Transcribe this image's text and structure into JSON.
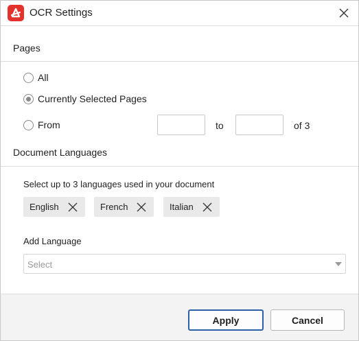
{
  "dialog": {
    "title": "OCR Settings",
    "icon": "app-logo-icon",
    "close_icon": "close-icon"
  },
  "pages": {
    "heading": "Pages",
    "options": [
      {
        "label": "All",
        "selected": false
      },
      {
        "label": "Currently Selected Pages",
        "selected": true
      },
      {
        "label": "From",
        "selected": false
      }
    ],
    "from_value": "",
    "to_value": "",
    "to_label": "to",
    "of_label": "of 3"
  },
  "languages": {
    "heading": "Document Languages",
    "helper": "Select up to 3 languages used in your document",
    "chips": [
      "English",
      "French",
      "Italian"
    ],
    "add_label": "Add Language",
    "select_placeholder": "Select"
  },
  "footer": {
    "apply_label": "Apply",
    "cancel_label": "Cancel"
  },
  "colors": {
    "brand": "#e2322b",
    "primary_border": "#2b5fa6",
    "chip_bg": "#e9e9e9",
    "footer_bg": "#f3f3f3"
  }
}
